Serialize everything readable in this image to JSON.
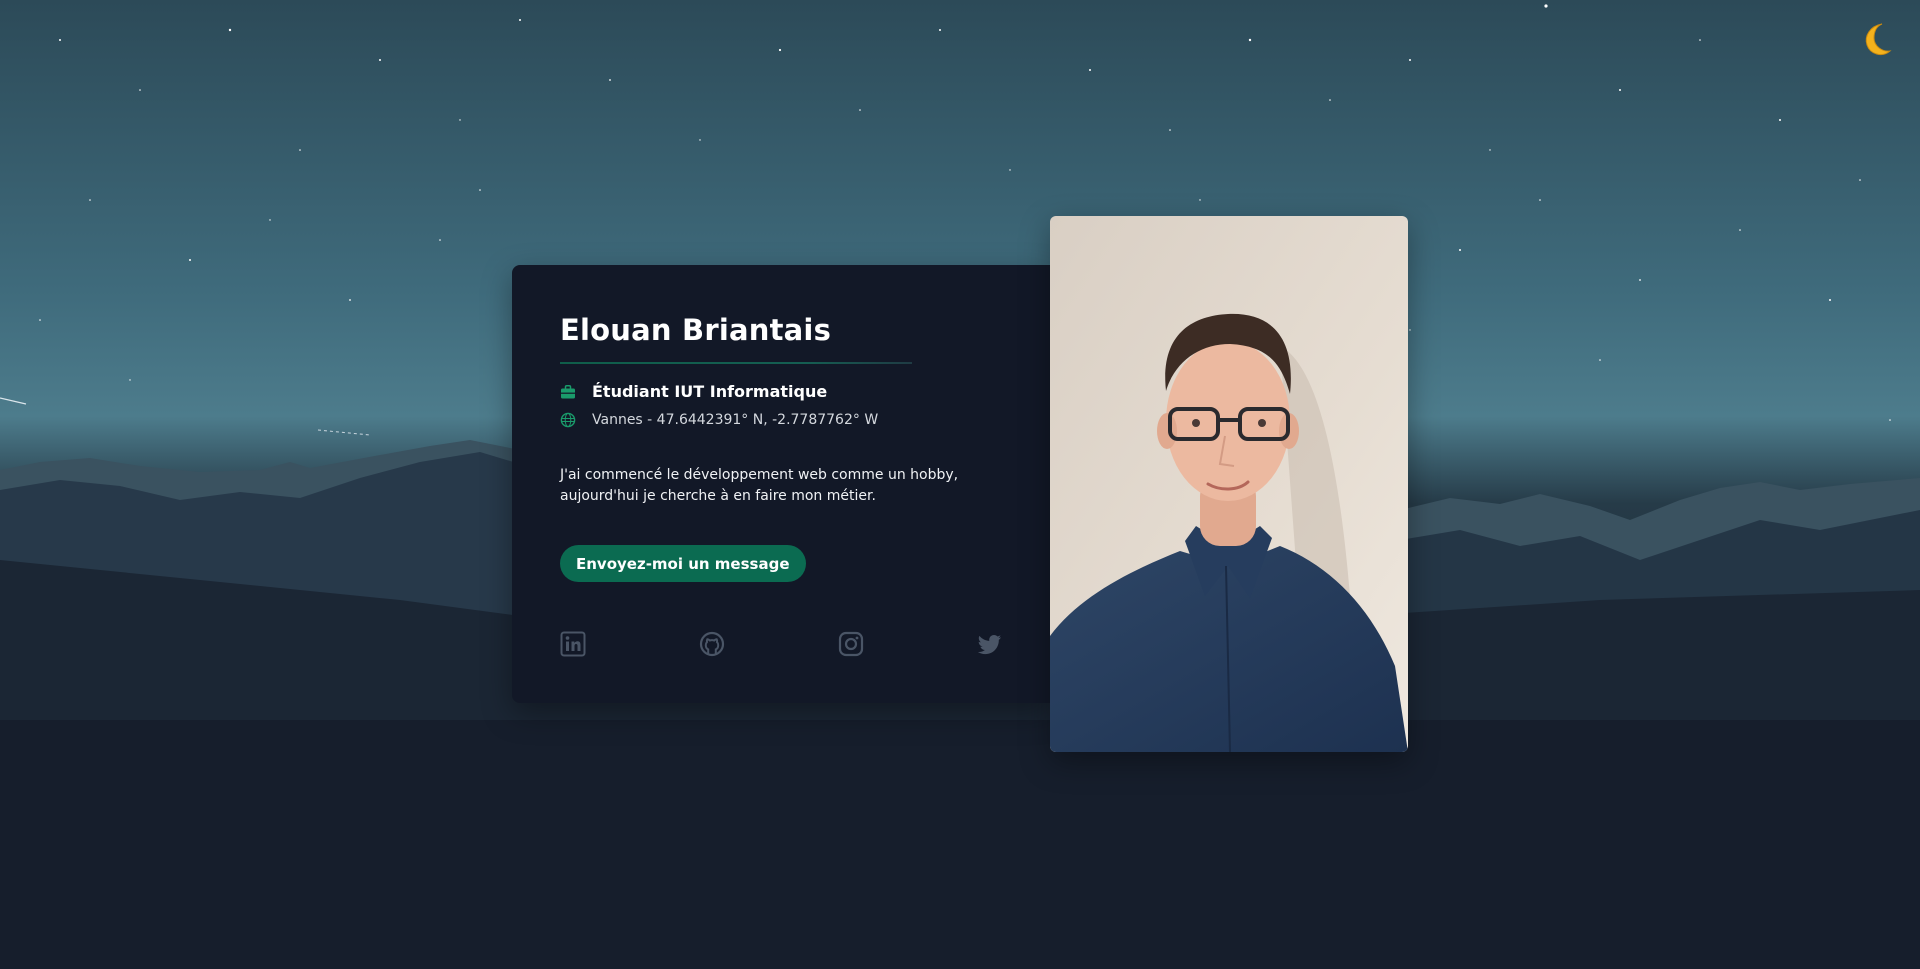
{
  "theme_toggle": {
    "icon": "crescent-moon-icon",
    "glyph": "🌙"
  },
  "profile": {
    "name": "Elouan Briantais",
    "job": "Étudiant IUT Informatique",
    "location": "Vannes - 47.6442391° N, -2.7787762° W",
    "bio_line1": "J'ai commencé le développement web comme un hobby,",
    "bio_line2": "aujourd'hui je cherche à en faire mon métier.",
    "cta_label": "Envoyez-moi un message"
  },
  "icons": {
    "job": "briefcase-icon",
    "location": "globe-icon",
    "socials": [
      "linkedin-icon",
      "github-icon",
      "instagram-icon",
      "twitter-icon"
    ]
  },
  "colors": {
    "accent": "#0b6b51",
    "icon_accent": "#1a9b6b",
    "card_background": "#121827",
    "social_icon": "#4a5566"
  }
}
